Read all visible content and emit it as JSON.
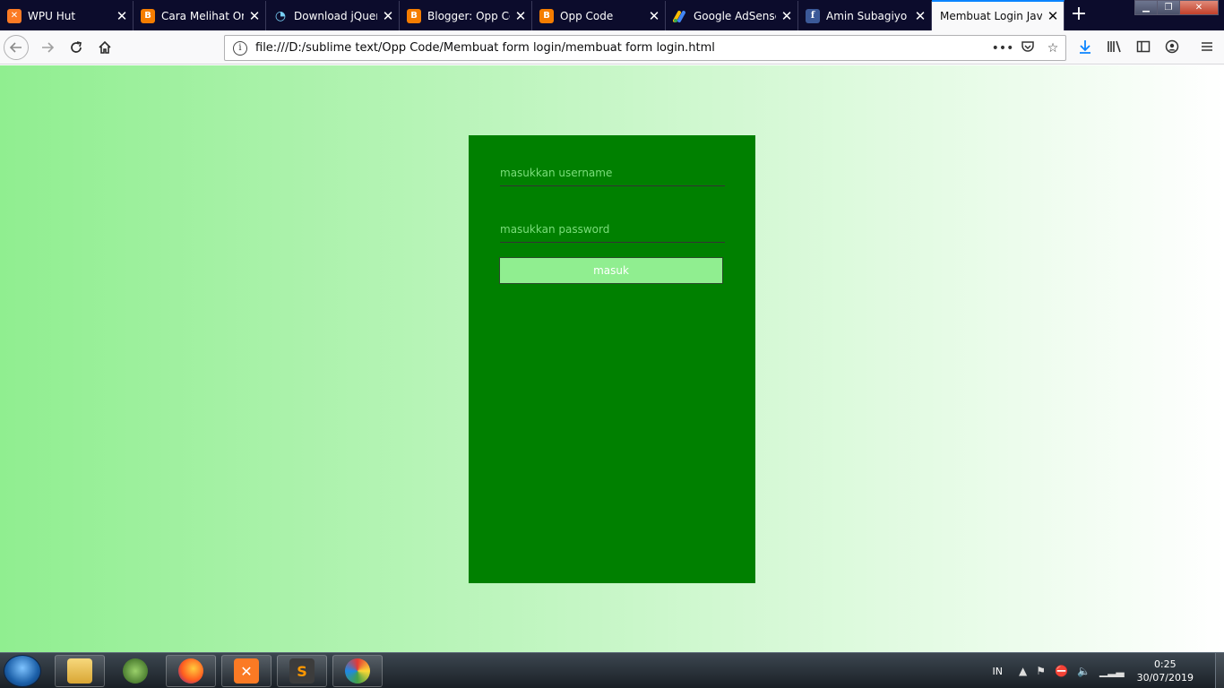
{
  "browser": {
    "tabs": [
      {
        "title": "WPU Hut",
        "icon": "xampp-icon"
      },
      {
        "title": "Cara Melihat Ora",
        "icon": "blogger-icon"
      },
      {
        "title": "Download jQuery",
        "icon": "jquery-icon"
      },
      {
        "title": "Blogger: Opp Co",
        "icon": "blogger-icon"
      },
      {
        "title": "Opp Code",
        "icon": "blogger-icon"
      },
      {
        "title": "Google AdSense",
        "icon": "adsense-icon"
      },
      {
        "title": "Amin Subagiyo",
        "icon": "facebook-icon"
      },
      {
        "title": "Membuat Login Java",
        "icon": "none",
        "active": true
      }
    ],
    "url": "file:///D:/sublime text/Opp Code/Membuat form login/membuat form login.html"
  },
  "login": {
    "username_placeholder": "masukkan username",
    "password_placeholder": "masukkan password",
    "submit_label": "masuk"
  },
  "taskbar": {
    "language": "IN",
    "time": "0:25",
    "date": "30/07/2019"
  },
  "colors": {
    "gradient_start": "#90ee90",
    "gradient_end": "#ffffff",
    "form_bg": "#008000",
    "button_bg": "#90ee90"
  }
}
